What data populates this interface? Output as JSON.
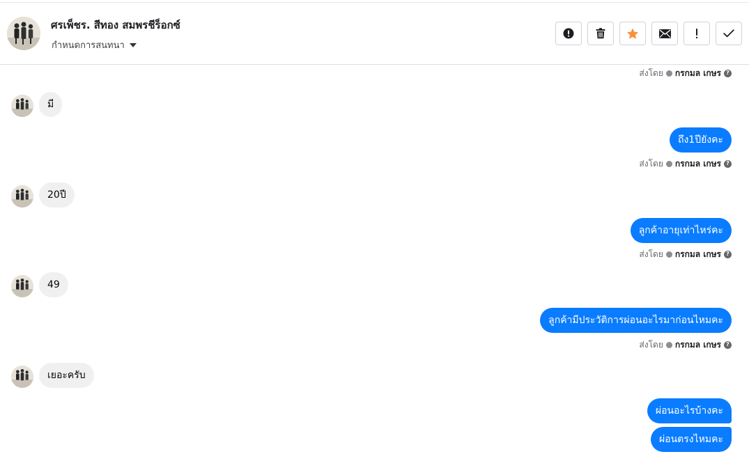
{
  "header": {
    "contact_name": "ศรเพ็ชร. สีทอง สมพรชีร็อกซ์",
    "assign_label": "กำหนดการสนทนา",
    "actions": [
      {
        "icon": "alert-circle-icon",
        "name": "report-button"
      },
      {
        "icon": "trash-icon",
        "name": "delete-button"
      },
      {
        "icon": "star-icon",
        "name": "star-button"
      },
      {
        "icon": "envelope-icon",
        "name": "mark-unread-button"
      },
      {
        "icon": "exclamation-icon",
        "name": "spam-button"
      },
      {
        "icon": "check-icon",
        "name": "done-button"
      }
    ],
    "star_color": "#f7923a"
  },
  "thread": {
    "sent_by_prefix": "ส่งโดย",
    "agent_name": "กรกมล เกษร",
    "help_glyph": "?",
    "messages": [
      {
        "direction": "in",
        "text": "มี"
      },
      {
        "direction": "out",
        "text": "ถึง1ปียังคะ"
      },
      {
        "direction": "in",
        "text": "20ปี"
      },
      {
        "direction": "out",
        "text": "ลูกค้าอายุเท่าไหร่คะ"
      },
      {
        "direction": "in",
        "text": "49"
      },
      {
        "direction": "out",
        "text": "ลูกค้ามีประวัติการผ่อนอะไรมาก่อนไหมคะ"
      },
      {
        "direction": "in",
        "text": "เยอะครับ"
      },
      {
        "direction": "out",
        "text": "ผ่อนอะไรบ้างคะ"
      },
      {
        "direction": "out",
        "text": "ผ่อนตรงไหมคะ"
      }
    ]
  },
  "colors": {
    "outgoing_bubble": "#0a7cff",
    "incoming_bubble": "#f0f0f0"
  }
}
